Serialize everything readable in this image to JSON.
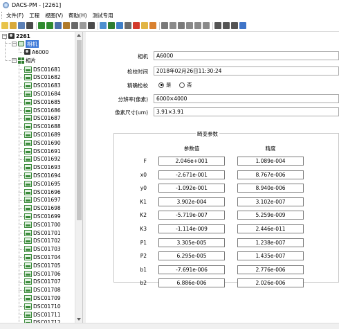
{
  "window": {
    "title": "DACS-PM - [2261]"
  },
  "menu": [
    "文件(F)",
    "工程",
    "视图(V)",
    "帮助(H)",
    "测试专用"
  ],
  "toolbar_icons": [
    {
      "name": "new-icon",
      "color": "#e8c34a"
    },
    {
      "name": "open-icon",
      "color": "#d9a93a"
    },
    {
      "name": "save-icon",
      "color": "#5b7fb5"
    },
    {
      "name": "grid-view-icon",
      "color": "#4a4a4a"
    },
    {
      "name": "undo-icon",
      "color": "#2f8a2f"
    },
    {
      "name": "redo-icon",
      "color": "#2f8a2f"
    },
    {
      "name": "zoom-icon",
      "color": "#4b6fa8"
    },
    {
      "name": "measure-icon",
      "color": "#b07a2a"
    },
    {
      "name": "flip-icon",
      "color": "#6a6a6a"
    },
    {
      "name": "ruler-icon",
      "color": "#9b9b9b"
    },
    {
      "name": "calc-icon",
      "color": "#4a4a4a"
    },
    {
      "name": "image-icon",
      "color": "#4d8fd0"
    },
    {
      "name": "chart-icon",
      "color": "#2e7d32"
    },
    {
      "name": "globe-icon",
      "color": "#3f7fc8"
    },
    {
      "name": "camera-icon",
      "color": "#6c6c6c"
    },
    {
      "name": "stop-icon",
      "color": "#d33a2c"
    },
    {
      "name": "folder-icon",
      "color": "#e2b544"
    },
    {
      "name": "settings-icon",
      "color": "#d9812f"
    },
    {
      "name": "table-icon",
      "color": "#7a7a7a"
    },
    {
      "name": "copy-icon",
      "color": "#8a8a8a"
    },
    {
      "name": "list-icon",
      "color": "#7a7a7a"
    },
    {
      "name": "doc-a-icon",
      "color": "#8a8a8a"
    },
    {
      "name": "doc-b-icon",
      "color": "#8a8a8a"
    },
    {
      "name": "doc-c-icon",
      "color": "#8a8a8a"
    },
    {
      "name": "photo-icon",
      "color": "#555555"
    },
    {
      "name": "print-icon",
      "color": "#555555"
    },
    {
      "name": "pan-icon",
      "color": "#555555"
    },
    {
      "name": "help-icon",
      "color": "#3f74c8"
    }
  ],
  "tree": {
    "root": "2261",
    "camera_group": "相机",
    "camera": "A6000",
    "photos_group": "相片",
    "photos": [
      "DSC01681",
      "DSC01682",
      "DSC01683",
      "DSC01684",
      "DSC01685",
      "DSC01686",
      "DSC01687",
      "DSC01688",
      "DSC01689",
      "DSC01690",
      "DSC01691",
      "DSC01692",
      "DSC01693",
      "DSC01694",
      "DSC01695",
      "DSC01696",
      "DSC01697",
      "DSC01698",
      "DSC01699",
      "DSC01700",
      "DSC01701",
      "DSC01702",
      "DSC01703",
      "DSC01704",
      "DSC01705",
      "DSC01706",
      "DSC01707",
      "DSC01708",
      "DSC01709",
      "DSC01710",
      "DSC01711",
      "DSC01712"
    ]
  },
  "form": {
    "camera_label": "相机",
    "camera_value": "A6000",
    "time_label": "检校时间",
    "time_value": "2018年02月26日11:30:24",
    "calibrated_label": "精确检校",
    "radio_yes": "是",
    "radio_no": "否",
    "resolution_label": "分辨率(像素)",
    "resolution_value": "6000×4000",
    "pixel_label": "像素尺寸(um)",
    "pixel_value": "3.91×3.91"
  },
  "params": {
    "title": "畸变参数",
    "col_value": "参数值",
    "col_precision": "精度",
    "rows": [
      {
        "name": "F",
        "value": "2.046e+001",
        "precision": "1.089e-004"
      },
      {
        "name": "x0",
        "value": "-2.671e-001",
        "precision": "8.767e-006"
      },
      {
        "name": "y0",
        "value": "-1.092e-001",
        "precision": "8.940e-006"
      },
      {
        "name": "K1",
        "value": "3.902e-004",
        "precision": "3.102e-007"
      },
      {
        "name": "K2",
        "value": "-5.719e-007",
        "precision": "5.259e-009"
      },
      {
        "name": "K3",
        "value": "-1.114e-009",
        "precision": "2.446e-011"
      },
      {
        "name": "P1",
        "value": "3.305e-005",
        "precision": "1.238e-007"
      },
      {
        "name": "P2",
        "value": "6.295e-005",
        "precision": "1.435e-007"
      },
      {
        "name": "b1",
        "value": "-7.691e-006",
        "precision": "2.776e-006"
      },
      {
        "name": "b2",
        "value": "6.886e-006",
        "precision": "2.026e-006"
      }
    ]
  }
}
